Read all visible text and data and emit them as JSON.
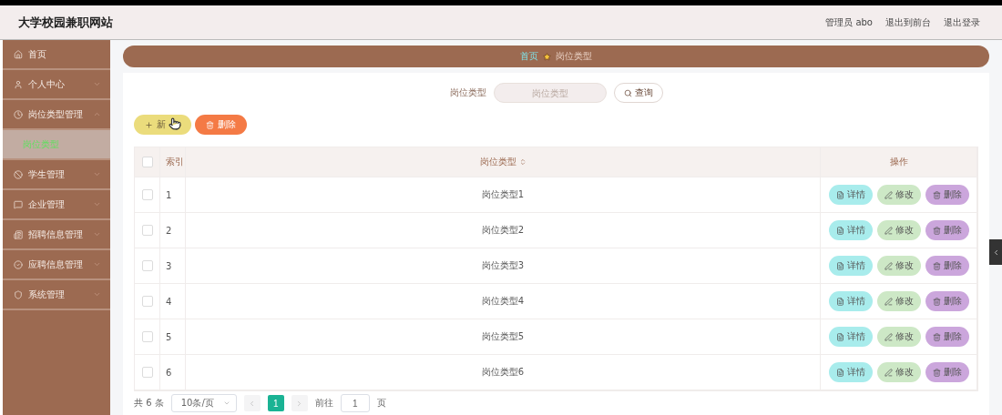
{
  "header": {
    "title": "大学校园兼职网站",
    "user": "管理员 abo",
    "links": [
      "退出到前台",
      "退出登录"
    ]
  },
  "sidebar": {
    "items": [
      {
        "label": "首页",
        "selected": false
      },
      {
        "label": "个人中心",
        "selected": false,
        "expanded": false
      },
      {
        "label": "岗位类型管理",
        "selected": false,
        "expanded": true,
        "children": [
          {
            "label": "岗位类型",
            "selected": true
          }
        ]
      },
      {
        "label": "学生管理",
        "selected": false,
        "expanded": false
      },
      {
        "label": "企业管理",
        "selected": false,
        "expanded": false
      },
      {
        "label": "招聘信息管理",
        "selected": false,
        "expanded": false
      },
      {
        "label": "应聘信息管理",
        "selected": false,
        "expanded": false
      },
      {
        "label": "系统管理",
        "selected": false,
        "expanded": false
      }
    ]
  },
  "breadcrumb": [
    "首页",
    "岗位类型"
  ],
  "search": {
    "label": "岗位类型",
    "placeholder": "岗位类型",
    "button": "查询"
  },
  "toolbar": [
    {
      "kind": "add",
      "label": "新"
    },
    {
      "kind": "delete",
      "label": "删除"
    }
  ],
  "table": {
    "select_all": {
      "checked": false
    },
    "columns": [
      "索引",
      "岗位类型",
      "操作"
    ],
    "rows": [
      {
        "index": "1",
        "type": "岗位类型1",
        "checked": false,
        "actions": [
          {
            "kind": "detail",
            "label": "详情"
          },
          {
            "kind": "edit",
            "label": "修改"
          },
          {
            "kind": "delete",
            "label": "删除"
          }
        ]
      },
      {
        "index": "2",
        "type": "岗位类型2",
        "checked": false,
        "actions": [
          {
            "kind": "detail",
            "label": "详情"
          },
          {
            "kind": "edit",
            "label": "修改"
          },
          {
            "kind": "delete",
            "label": "删除"
          }
        ]
      },
      {
        "index": "3",
        "type": "岗位类型3",
        "checked": false,
        "actions": [
          {
            "kind": "detail",
            "label": "详情"
          },
          {
            "kind": "edit",
            "label": "修改"
          },
          {
            "kind": "delete",
            "label": "删除"
          }
        ]
      },
      {
        "index": "4",
        "type": "岗位类型4",
        "checked": false,
        "actions": [
          {
            "kind": "detail",
            "label": "详情"
          },
          {
            "kind": "edit",
            "label": "修改"
          },
          {
            "kind": "delete",
            "label": "删除"
          }
        ]
      },
      {
        "index": "5",
        "type": "岗位类型5",
        "checked": false,
        "actions": [
          {
            "kind": "detail",
            "label": "详情"
          },
          {
            "kind": "edit",
            "label": "修改"
          },
          {
            "kind": "delete",
            "label": "删除"
          }
        ]
      },
      {
        "index": "6",
        "type": "岗位类型6",
        "checked": false,
        "actions": [
          {
            "kind": "detail",
            "label": "详情"
          },
          {
            "kind": "edit",
            "label": "修改"
          },
          {
            "kind": "delete",
            "label": "删除"
          }
        ]
      }
    ]
  },
  "pagination": {
    "total": "共 6 条",
    "page_size": "10条/页",
    "pages": [
      {
        "label": "1",
        "selected": true
      }
    ],
    "goto_label": "前往",
    "goto_value": "1",
    "goto_suffix": "页"
  }
}
